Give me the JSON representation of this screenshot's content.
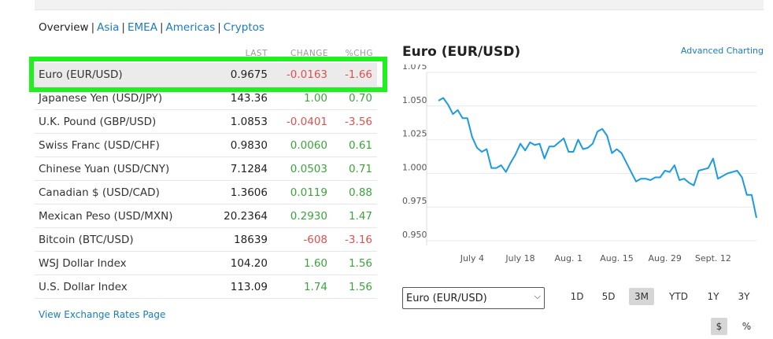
{
  "tabs": [
    "Overview",
    "Asia",
    "EMEA",
    "Americas",
    "Cryptos"
  ],
  "table": {
    "columns": [
      "LAST",
      "CHANGE",
      "%CHG"
    ],
    "rows": [
      {
        "name": "Euro (EUR/USD)",
        "last": "0.9675",
        "change": "-0.0163",
        "pct": "-1.66",
        "dir": "neg"
      },
      {
        "name": "Japanese Yen (USD/JPY)",
        "last": "143.36",
        "change": "1.00",
        "pct": "0.70",
        "dir": "pos"
      },
      {
        "name": "U.K. Pound (GBP/USD)",
        "last": "1.0853",
        "change": "-0.0401",
        "pct": "-3.56",
        "dir": "neg"
      },
      {
        "name": "Swiss Franc (USD/CHF)",
        "last": "0.9830",
        "change": "0.0060",
        "pct": "0.61",
        "dir": "pos"
      },
      {
        "name": "Chinese Yuan (USD/CNY)",
        "last": "7.1284",
        "change": "0.0503",
        "pct": "0.71",
        "dir": "pos"
      },
      {
        "name": "Canadian $ (USD/CAD)",
        "last": "1.3606",
        "change": "0.0119",
        "pct": "0.88",
        "dir": "pos"
      },
      {
        "name": "Mexican Peso (USD/MXN)",
        "last": "20.2364",
        "change": "0.2930",
        "pct": "1.47",
        "dir": "pos"
      },
      {
        "name": "Bitcoin (BTC/USD)",
        "last": "18639",
        "change": "-608",
        "pct": "-3.16",
        "dir": "neg"
      },
      {
        "name": "WSJ Dollar Index",
        "last": "104.20",
        "change": "1.60",
        "pct": "1.56",
        "dir": "pos"
      },
      {
        "name": "U.S. Dollar Index",
        "last": "113.09",
        "change": "1.74",
        "pct": "1.56",
        "dir": "pos"
      }
    ]
  },
  "view_link": "View Exchange Rates Page",
  "chart_title": "Euro (EUR/USD)",
  "advanced_link": "Advanced Charting",
  "selector": {
    "selected": "Euro (EUR/USD)"
  },
  "ranges": [
    "1D",
    "5D",
    "3M",
    "YTD",
    "1Y",
    "3Y"
  ],
  "active_range": "3M",
  "units": [
    "$",
    "%"
  ],
  "active_unit": "$",
  "colors": {
    "line": "#1c9be0",
    "positive": "#3aa53a",
    "negative": "#e0504f",
    "highlight": "#1ef11e"
  },
  "chart_data": {
    "type": "line",
    "title": "Euro (EUR/USD)",
    "ylim": [
      0.95,
      1.075
    ],
    "yticks": [
      "1.075",
      "1.050",
      "1.025",
      "1.000",
      "0.975",
      "0.950"
    ],
    "xticks": [
      "July 4",
      "July 18",
      "Aug. 1",
      "Aug. 15",
      "Aug. 29",
      "Sept. 12"
    ],
    "xtick_index": [
      7,
      17,
      27,
      37,
      47,
      57
    ],
    "values": [
      1.054,
      1.056,
      1.051,
      1.044,
      1.047,
      1.041,
      1.041,
      1.027,
      1.019,
      1.016,
      1.018,
      1.004,
      1.004,
      1.006,
      1.001,
      1.008,
      1.014,
      1.022,
      1.017,
      1.023,
      1.021,
      1.022,
      1.011,
      1.02,
      1.02,
      1.023,
      1.026,
      1.016,
      1.016,
      1.025,
      1.018,
      1.019,
      1.022,
      1.031,
      1.033,
      1.028,
      1.015,
      1.018,
      1.015,
      1.008,
      1.001,
      0.994,
      0.996,
      0.996,
      0.995,
      0.997,
      0.997,
      1.002,
      1.001,
      1.006,
      0.995,
      0.996,
      0.993,
      0.991,
      1.002,
      1.003,
      1.004,
      1.011,
      0.996,
      0.998,
      1.0,
      1.001,
      1.002,
      0.997,
      0.984,
      0.984,
      0.967
    ]
  }
}
